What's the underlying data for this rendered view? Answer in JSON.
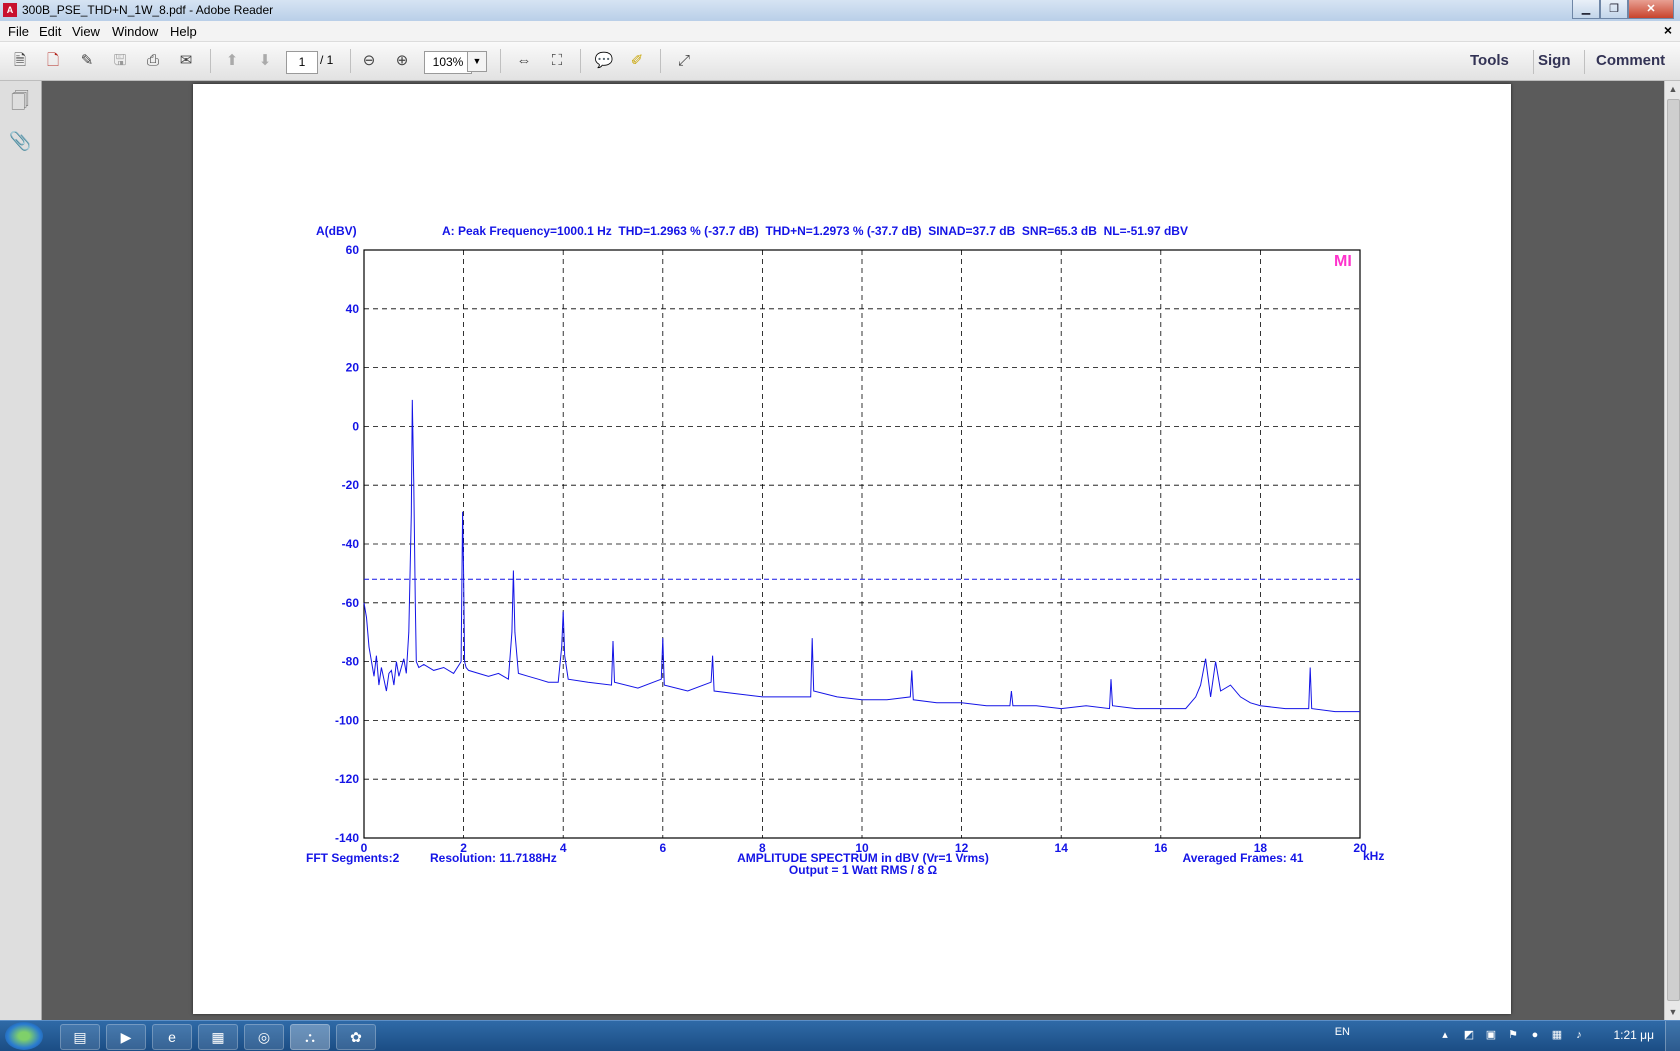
{
  "window": {
    "title": "300B_PSE_THD+N_1W_8.pdf - Adobe Reader",
    "minimize": "▁",
    "restore": "❐",
    "close": "✕"
  },
  "menubar": {
    "items": [
      "File",
      "Edit",
      "View",
      "Window",
      "Help"
    ],
    "doc_close": "×"
  },
  "toolbar": {
    "page_current": "1",
    "page_total": "/ 1",
    "zoom": "103%",
    "zoom_dropdown_arrow": "▼",
    "tools_label": "Tools",
    "sign_label": "Sign",
    "comment_label": "Comment",
    "icons": [
      "create-icon",
      "export-icon",
      "edit-icon",
      "save-icon",
      "print-icon",
      "email-icon",
      "prev-page-icon",
      "next-page-icon",
      "zoom-out-icon",
      "zoom-in-icon",
      "fit-page-icon",
      "fit-width-icon",
      "comment-icon",
      "highlight-icon",
      "fullscreen-icon"
    ]
  },
  "navpane": {
    "icons": [
      "pages-icon",
      "attachments-icon"
    ]
  },
  "chart_data": {
    "type": "line",
    "y_axis_label": "A(dBV)",
    "x_unit_label": "kHz",
    "header": "A: Peak Frequency=1000.1 Hz  THD=1.2963 % (-37.7 dB)  THD+N=1.2973 % (-37.7 dB)  SINAD=37.7 dB  SNR=65.3 dB  NL=-51.97 dBV",
    "xlim": [
      0,
      20
    ],
    "ylim": [
      -140,
      60
    ],
    "x_ticks": [
      "0",
      "2",
      "4",
      "6",
      "8",
      "10",
      "12",
      "14",
      "16",
      "18",
      "20"
    ],
    "y_ticks": [
      "60",
      "40",
      "20",
      "0",
      "-20",
      "-40",
      "-60",
      "-80",
      "-100",
      "-120",
      "-140"
    ],
    "grid": true,
    "noise_level_line": -51.97,
    "logo_mark": "MI",
    "footer_left_1": "FFT Segments:2",
    "footer_left_2": "Resolution: 11.7188Hz",
    "footer_center_1": "AMPLITUDE SPECTRUM in dBV (Vr=1 Vrms)",
    "footer_center_2": "Output = 1 Watt RMS / 8 Ω",
    "footer_right": "Averaged Frames: 41",
    "series": [
      {
        "values_x": [
          0.0,
          0.05,
          0.1,
          0.15,
          0.2,
          0.25,
          0.3,
          0.35,
          0.4,
          0.45,
          0.5,
          0.55,
          0.6,
          0.65,
          0.7,
          0.75,
          0.8,
          0.85,
          0.9,
          0.95,
          0.97,
          1.0,
          1.03,
          1.05,
          1.1,
          1.2,
          1.4,
          1.6,
          1.8,
          1.95,
          1.98,
          2.0,
          2.02,
          2.05,
          2.1,
          2.3,
          2.5,
          2.7,
          2.9,
          2.97,
          3.0,
          3.03,
          3.1,
          3.3,
          3.5,
          3.7,
          3.9,
          3.97,
          4.0,
          4.03,
          4.1,
          4.5,
          4.97,
          5.0,
          5.03,
          5.5,
          5.97,
          6.0,
          6.03,
          6.5,
          6.97,
          7.0,
          7.03,
          7.5,
          8.0,
          8.5,
          8.97,
          9.0,
          9.03,
          9.5,
          10.0,
          10.5,
          10.97,
          11.0,
          11.03,
          11.5,
          12.0,
          12.5,
          12.97,
          13.0,
          13.03,
          13.5,
          14.0,
          14.5,
          14.97,
          15.0,
          15.03,
          15.5,
          16.0,
          16.5,
          16.7,
          16.8,
          16.9,
          17.0,
          17.1,
          17.2,
          17.4,
          17.6,
          17.8,
          18.0,
          18.5,
          18.97,
          19.0,
          19.03,
          19.5,
          20.0
        ],
        "values_y": [
          -60,
          -65,
          -75,
          -80,
          -85,
          -78,
          -88,
          -82,
          -86,
          -90,
          -84,
          -83,
          -88,
          -80,
          -85,
          -82,
          -79,
          -84,
          -70,
          -30,
          9,
          -20,
          -60,
          -80,
          -82,
          -81,
          -83,
          -82,
          -84,
          -80,
          -29,
          -50,
          -80,
          -82,
          -83,
          -84,
          -85,
          -84,
          -86,
          -70,
          -49,
          -70,
          -84,
          -85,
          -86,
          -87,
          -87,
          -75,
          -63,
          -78,
          -86,
          -87,
          -88,
          -73,
          -87,
          -89,
          -86,
          -72,
          -88,
          -90,
          -87,
          -78,
          -90,
          -91,
          -92,
          -92,
          -92,
          -72,
          -90,
          -92,
          -93,
          -93,
          -92,
          -83,
          -93,
          -94,
          -94,
          -95,
          -95,
          -90,
          -95,
          -95,
          -96,
          -95,
          -96,
          -86,
          -95,
          -96,
          -96,
          -96,
          -92,
          -88,
          -79,
          -92,
          -80,
          -90,
          -88,
          -92,
          -94,
          -95,
          -96,
          -96,
          -82,
          -96,
          -97,
          -97
        ]
      }
    ]
  },
  "taskbar": {
    "apps": [
      "explorer-icon",
      "media-player-icon",
      "ie-icon",
      "calculator-icon",
      "folder-icon",
      "acrobat-icon",
      "app-icon"
    ],
    "lang": "EN",
    "clock": "1:21 μμ",
    "tray_icons": [
      "show-hidden-icon",
      "tray-icon-1",
      "tray-icon-2",
      "flag-icon",
      "tray-icon-3",
      "network-icon",
      "volume-icon"
    ]
  }
}
